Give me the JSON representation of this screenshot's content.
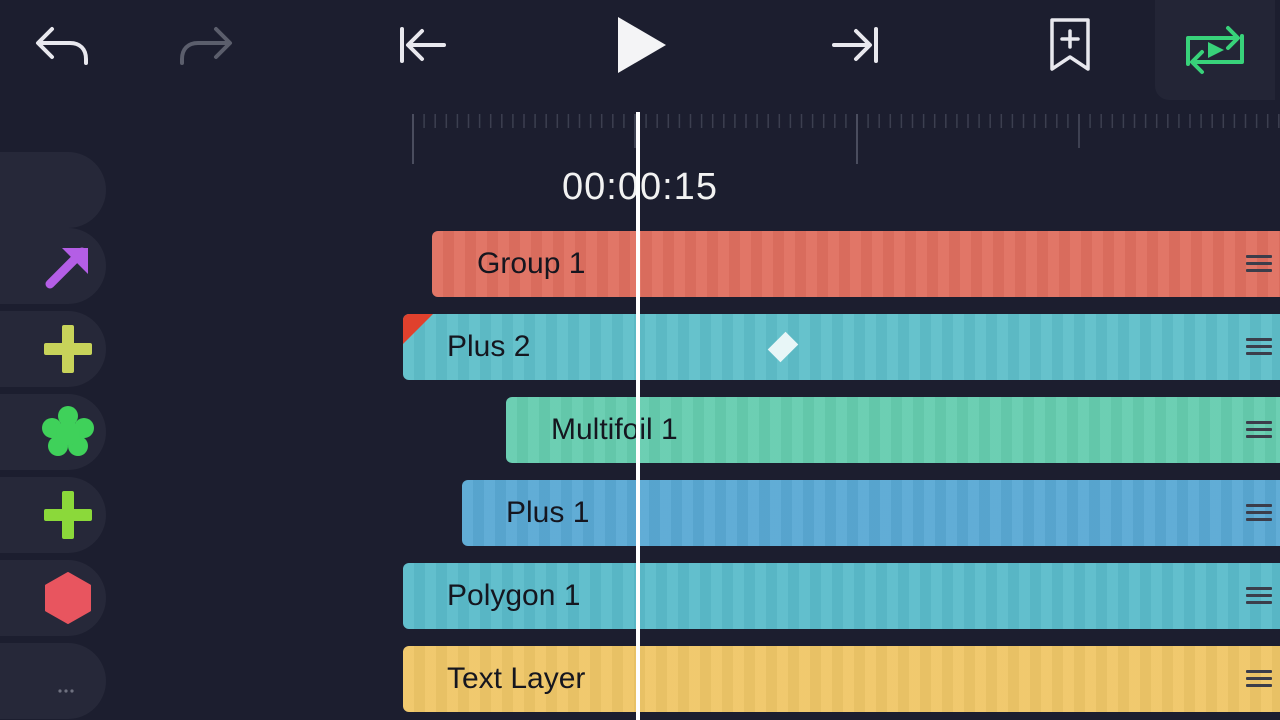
{
  "toolbar": {
    "undo_icon": "undo-icon",
    "redo_icon": "redo-icon",
    "first_frame_icon": "skip-to-start-icon",
    "play_icon": "play-icon",
    "last_frame_icon": "skip-to-end-icon",
    "bookmark_icon": "bookmark-add-icon",
    "loop_icon": "loop-playback-icon"
  },
  "timeline": {
    "timecode": "00:00:15"
  },
  "layers": [
    {
      "name": "Group 1",
      "icon": "arrow-icon",
      "icon_color": "#b45ee6",
      "track_color": "#e07060"
    },
    {
      "name": "Plus 2",
      "icon": "plus-icon",
      "icon_color": "#c7d35a",
      "track_color": "#5fbfca"
    },
    {
      "name": "Multifoil 1",
      "icon": "multifoil-icon",
      "icon_color": "#3fd15a",
      "track_color": "#66cdb0"
    },
    {
      "name": "Plus 1",
      "icon": "plus-icon",
      "icon_color": "#8bd93a",
      "track_color": "#5aa9d4"
    },
    {
      "name": "Polygon 1",
      "icon": "hexagon-icon",
      "icon_color": "#e8555f",
      "track_color": "#5bbccb"
    },
    {
      "name": "Text Layer",
      "icon": "text-icon",
      "icon_color": "#6f7180",
      "track_color": "#f0c768"
    }
  ],
  "colors": {
    "background": "#1c1e2f",
    "accent_loop": "#38d27a",
    "playhead": "#ffffff",
    "keyframe_marker": "#e0412d"
  }
}
